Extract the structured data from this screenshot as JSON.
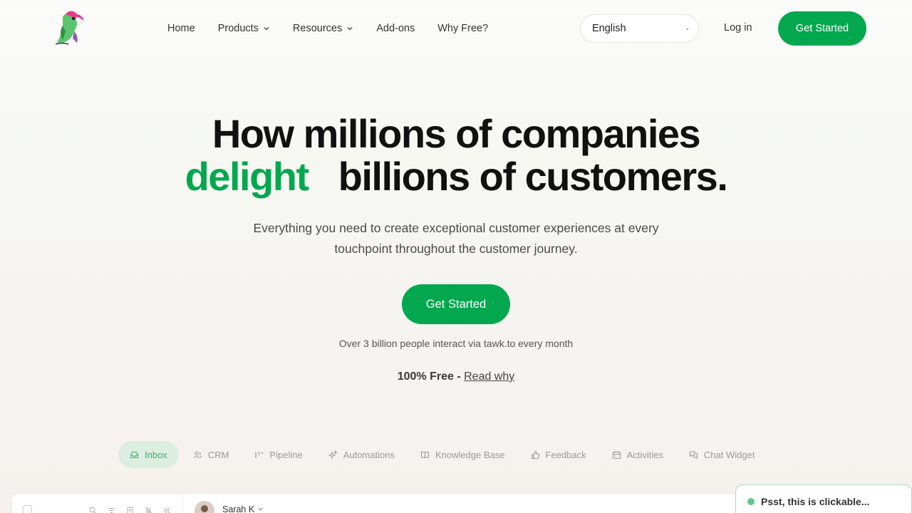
{
  "nav": {
    "links": [
      {
        "label": "Home",
        "has_dropdown": false
      },
      {
        "label": "Products",
        "has_dropdown": true
      },
      {
        "label": "Resources",
        "has_dropdown": true
      },
      {
        "label": "Add-ons",
        "has_dropdown": false
      },
      {
        "label": "Why Free?",
        "has_dropdown": false
      }
    ],
    "language": "English",
    "login": "Log in",
    "cta": "Get Started"
  },
  "hero": {
    "line1": "How millions of companies",
    "line2_highlight": "delight",
    "line2_rest": "billions of customers.",
    "subtitle": "Everything you need to create exceptional customer experiences at every touchpoint throughout the customer journey.",
    "cta": "Get Started",
    "stat": "Over 3 billion people interact via tawk.to every month",
    "free_bold": "100% Free -",
    "free_link": "Read why"
  },
  "tabs": [
    {
      "label": "Inbox",
      "icon": "inbox-icon",
      "active": true
    },
    {
      "label": "CRM",
      "icon": "users-icon",
      "active": false
    },
    {
      "label": "Pipeline",
      "icon": "pipeline-icon",
      "active": false
    },
    {
      "label": "Automations",
      "icon": "sparkle-icon",
      "active": false
    },
    {
      "label": "Knowledge Base",
      "icon": "book-icon",
      "active": false
    },
    {
      "label": "Feedback",
      "icon": "thumbs-up-icon",
      "active": false
    },
    {
      "label": "Activities",
      "icon": "calendar-icon",
      "active": false
    },
    {
      "label": "Chat Widget",
      "icon": "chat-icon",
      "active": false
    }
  ],
  "preview": {
    "contact_name": "Sarah K"
  },
  "toast": {
    "text": "Psst, this is clickable..."
  },
  "colors": {
    "accent": "#03a84e",
    "tab_active_bg": "#dceee2"
  }
}
